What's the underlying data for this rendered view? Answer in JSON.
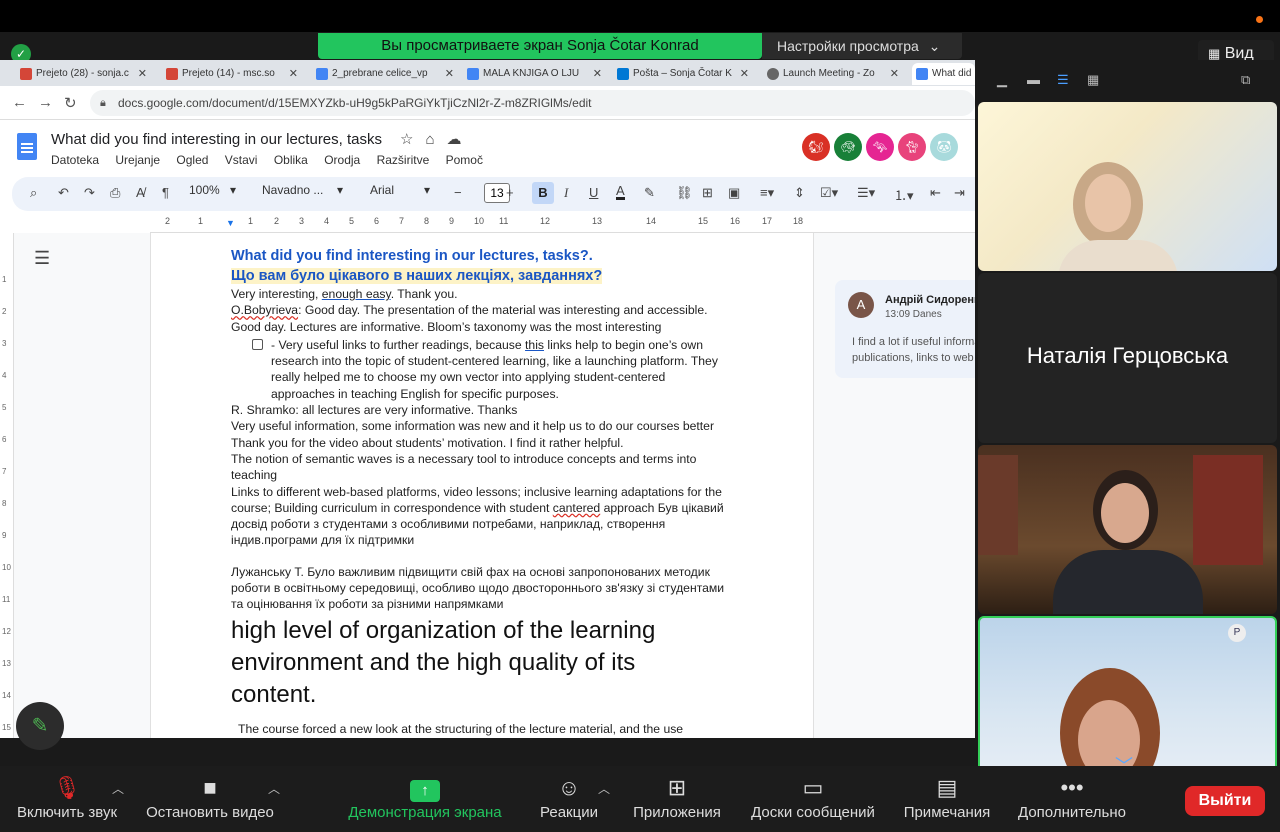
{
  "zoom": {
    "share_banner": "Вы просматриваете экран Sonja Čotar Konrad",
    "view_settings": "Настройки просмотра",
    "view_button": "Вид",
    "toolbar": {
      "mute": "Включить звук",
      "video": "Остановить видео",
      "share": "Демонстрация экрана",
      "reactions": "Реакции",
      "apps": "Приложения",
      "whiteboards": "Доски сообщений",
      "notes": "Примечания",
      "more": "Дополнительно",
      "leave": "Выйти"
    },
    "participants": {
      "tile2_name": "Наталія Герцовська"
    }
  },
  "browser": {
    "tabs": [
      {
        "label": "Prejeto (28) - sonja.c",
        "color": "#d44638"
      },
      {
        "label": "Prejeto (14) - msc.so",
        "color": "#d44638"
      },
      {
        "label": "2_prebrane celice_vp",
        "color": "#4285f4"
      },
      {
        "label": "MALA KNJIGA O LJU",
        "color": "#4285f4"
      },
      {
        "label": "Pošta – Sonja Čotar K",
        "color": "#0078d4"
      },
      {
        "label": "Launch Meeting - Zo",
        "color": "#666666"
      },
      {
        "label": "What did",
        "color": "#4285f4"
      }
    ],
    "url": "docs.google.com/document/d/15EMXYZkb-uH9g5kPaRGiYkTjiCzNl2r-Z-m8ZRIGlMs/edit"
  },
  "doc": {
    "title": "What did you find interesting in our lectures, tasks",
    "menu": [
      "Datoteka",
      "Urejanje",
      "Ogled",
      "Vstavi",
      "Oblika",
      "Orodja",
      "Razširitve",
      "Pomoč"
    ],
    "toolbar": {
      "zoom": "100%",
      "style": "Navadno ...",
      "font": "Arial",
      "size": "13"
    },
    "ruler": [
      "2",
      "1",
      "1",
      "2",
      "3",
      "4",
      "5",
      "6",
      "7",
      "8",
      "9",
      "10",
      "11",
      "12",
      "13",
      "14",
      "15",
      "16",
      "17",
      "18"
    ],
    "vruler": [
      "1",
      "2",
      "3",
      "4",
      "5",
      "6",
      "7",
      "8",
      "9",
      "10",
      "11",
      "12",
      "13",
      "14",
      "15"
    ],
    "comment": {
      "initial": "A",
      "author": "Андрій Сидоренко",
      "time": "13:09 Danes",
      "text": "I find a lot if useful information, publications, links to web"
    },
    "heading_en": "What did you find interesting in our lectures, tasks?.",
    "heading_ua": "Що вам було цікавого в наших лекціях, завданнях?",
    "line1_a": "Very interesting, ",
    "line1_b": "enough easy",
    "line1_c": ". Thank you.",
    "line2_a": "O.Bobyrieva",
    "line2_b": ": Good day. The presentation of the material was interesting and accessible.",
    "line3": "Good day. Lectures are informative. Bloom’s taxonomy was the most interesting",
    "check1": "- Very useful links to further readings, because ",
    "check1_this": "this",
    "check1_end": " links help to begin one’s own",
    "check2": "research into the topic of student-centered learning, like a launching platform. They",
    "check3": "really helped me to choose my own vector into applying student-centered",
    "check4": "approaches in teaching English for specific purposes.",
    "line4": "R. Shramko: all lectures are very informative. Thanks",
    "line5": "Very useful information, some information was new and it help us to do our courses better",
    "line6": "Thank you for the video about students’ motivation. I find it rather helpful.",
    "line7": "The notion of semantic waves is a necessary tool to introduce concepts and terms into",
    "line8": "teaching",
    "line9": "Links to different web-based platforms, video lessons; inclusive learning adaptations for the",
    "line10_a": "course; Building curriculum in correspondence with student ",
    "line10_b": "cantered",
    "line10_c": " approach Був цікавий",
    "line11": "досвід роботи з студентами з особливими потребами, наприклад, створення",
    "line12": "індив.програми для їх підтримки",
    "line13": "Лужанську Т. Було важливим підвищити свій фах на основі запропонованих методик",
    "line14": "роботи в освітньому середовищі, особливо щодо двостороннього зв'язку зі студентами",
    "line15": "та оцінювання їх роботи за різними напрямками",
    "big1": "high level of organization of the learning",
    "big2": "environment and the high quality of its",
    "big3": "content.",
    "line16": "The course forced a new look at the structuring of the lecture material, and the use"
  }
}
